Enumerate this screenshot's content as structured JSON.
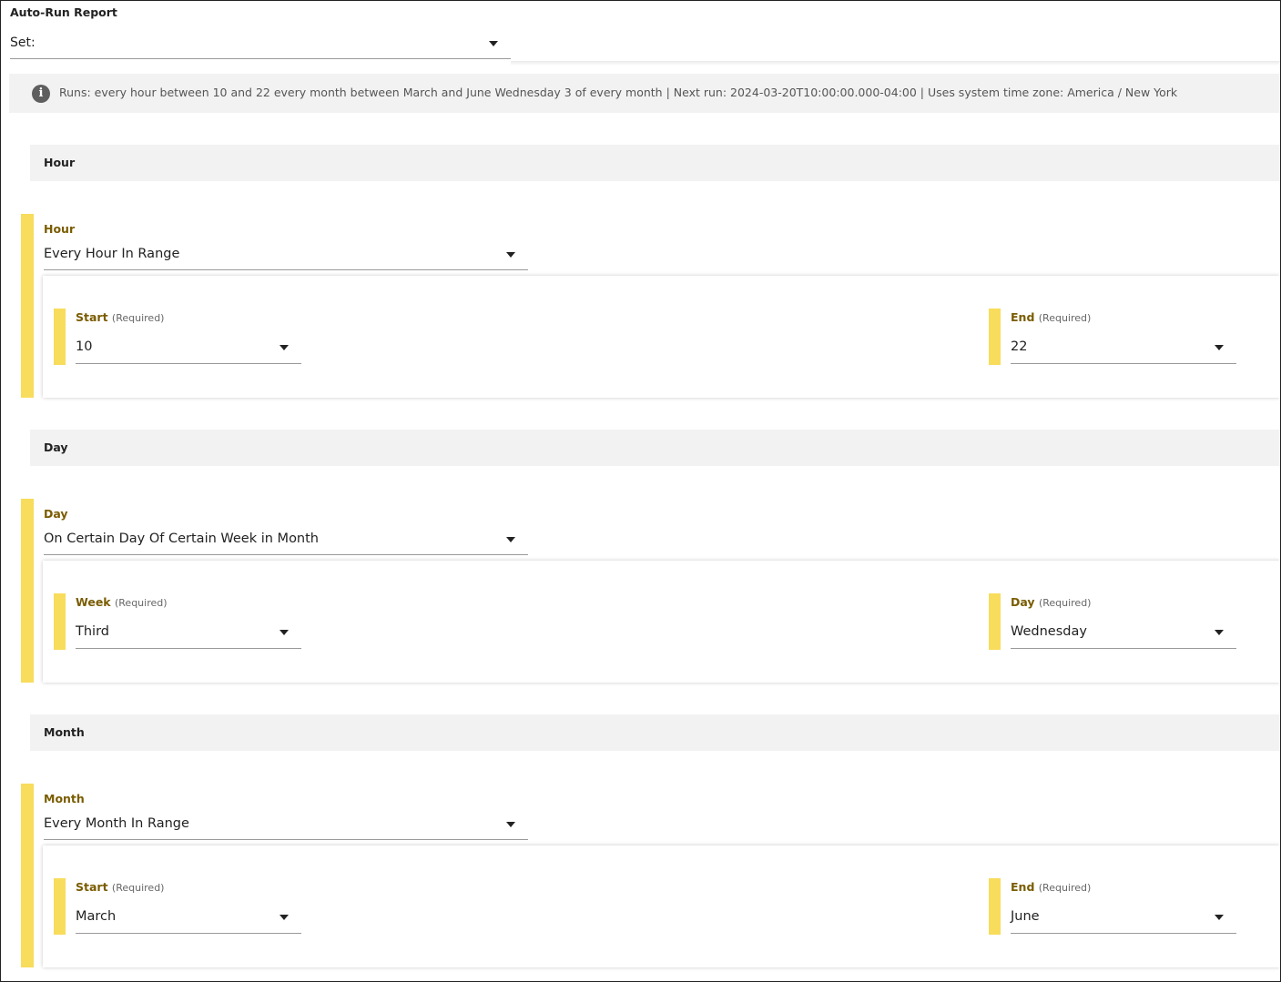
{
  "app_title": "Auto-Run Report",
  "set_select": {
    "label": "Set:"
  },
  "info": {
    "icon": "info-icon",
    "glyph": "i",
    "text": "Runs: every hour between 10 and 22 every month between March and June Wednesday 3 of every month | Next run: 2024-03-20T10:00:00.000-04:00 | Uses system time zone: America / New York"
  },
  "accent_color": "#f8dc5c",
  "required_text": "(Required)",
  "sections": {
    "hour": {
      "header": "Hour",
      "field_label": "Hour",
      "value": "Every Hour In Range",
      "left_label": "Start",
      "left_value": "10",
      "right_label": "End",
      "right_value": "22"
    },
    "day": {
      "header": "Day",
      "field_label": "Day",
      "value": "On Certain Day Of Certain Week in Month",
      "left_label": "Week",
      "left_value": "Third",
      "right_label": "Day",
      "right_value": "Wednesday"
    },
    "month": {
      "header": "Month",
      "field_label": "Month",
      "value": "Every Month In Range",
      "left_label": "Start",
      "left_value": "March",
      "right_label": "End",
      "right_value": "June"
    }
  }
}
